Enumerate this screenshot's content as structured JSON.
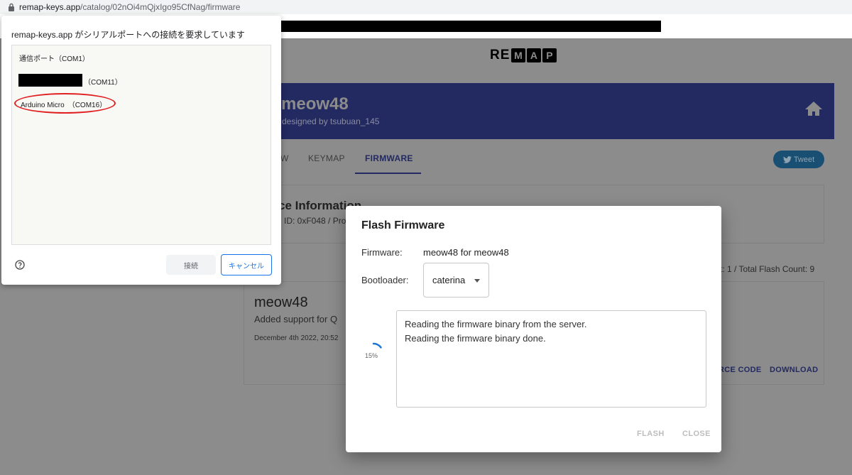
{
  "browser": {
    "url_host": "remap-keys.app",
    "url_path": "/catalog/02nOi4mQjxIgo95CfNag/firmware"
  },
  "page": {
    "logo_prefix": "RE",
    "logo_boxes": [
      "M",
      "A",
      "P"
    ],
    "keyboard_name": "meow48",
    "designer": "designed by tsubuan_145",
    "tabs": [
      "W",
      "KEYMAP",
      "FIRMWARE"
    ],
    "active_tab": "FIRMWARE",
    "tweet_label": "Tweet",
    "device_info_title": "ce Information",
    "device_info_sub": "ID: 0xF048 / Pro",
    "flash_count": "t: 1 / Total Flash Count: 9",
    "firmware_card": {
      "name": "meow48",
      "description": "Added support for Q",
      "date": "December 4th 2022, 20:52",
      "source_code_label": "RCE CODE",
      "download_label": "DOWNLOAD"
    }
  },
  "flash_dialog": {
    "title": "Flash Firmware",
    "firmware_label": "Firmware:",
    "firmware_value": "meow48 for meow48",
    "bootloader_label": "Bootloader:",
    "bootloader_value": "caterina",
    "progress_percent": "15%",
    "progress_fraction": 0.15,
    "log_lines": [
      "Reading the firmware binary from the server.",
      "Reading the firmware binary done."
    ],
    "flash_button": "FLASH",
    "close_button": "CLOSE"
  },
  "serial_chooser": {
    "title": "remap-keys.app がシリアルポートへの接続を要求しています",
    "ports": [
      "通信ポート（COM1）",
      "（COM11）",
      "Arduino Micro　（COM16）"
    ],
    "connect_button": "接続",
    "cancel_button": "キャンセル"
  },
  "colors": {
    "banner": "#232a61",
    "accent_blue": "#1a73e8",
    "annotation_red": "#e02020"
  }
}
